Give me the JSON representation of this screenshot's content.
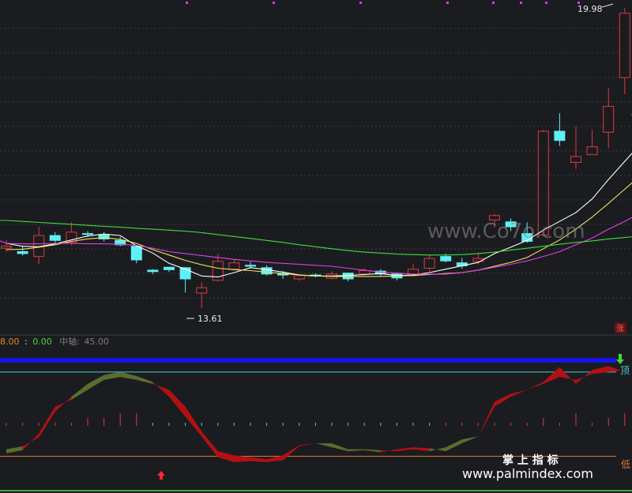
{
  "colors": {
    "background": "#1b1c20",
    "up_candle": "#e0393e",
    "down_candle": "#5ef0f4",
    "ma5": "#ffffff",
    "ma10": "#f0e25a",
    "ma20": "#e040e8",
    "ma60": "#3ddc3d",
    "band_bull": "#b31014",
    "band_bear": "#5a6d2e",
    "top_line": "#1616e8",
    "top_ref": "#3fd3d3",
    "low_ref": "#e07a2e",
    "bottom_line": "#3ddc3d",
    "grid": "#3a3d47"
  },
  "price_panel": {
    "high_label": "19.98",
    "low_label": "13.61",
    "zhang_badge": "涨",
    "watermark": "www.Co7o.com"
  },
  "indicator_panel": {
    "header": {
      "value_a": "8.00",
      "separator": ":",
      "value_b": "0.00",
      "axis_label": "中轴:",
      "axis_value": "45.00"
    },
    "top_marker": "顶",
    "low_marker": "低",
    "brand_cn": "掌 上 指 标",
    "brand_url": "www.palmindex.com"
  },
  "chart_data": [
    {
      "type": "candlestick",
      "title": "",
      "y_labels": {
        "high": 19.98,
        "low": 13.61
      },
      "candles": [
        {
          "o": 15.05,
          "h": 15.22,
          "l": 14.98,
          "c": 15.09
        },
        {
          "o": 14.98,
          "h": 15.1,
          "l": 14.9,
          "c": 14.94
        },
        {
          "o": 14.88,
          "h": 15.49,
          "l": 14.72,
          "c": 15.31
        },
        {
          "o": 15.31,
          "h": 15.38,
          "l": 15.16,
          "c": 15.21
        },
        {
          "o": 15.17,
          "h": 15.58,
          "l": 15.11,
          "c": 15.38
        },
        {
          "o": 15.35,
          "h": 15.4,
          "l": 15.28,
          "c": 15.34
        },
        {
          "o": 15.33,
          "h": 15.38,
          "l": 15.19,
          "c": 15.24
        },
        {
          "o": 15.21,
          "h": 15.28,
          "l": 15.09,
          "c": 15.12
        },
        {
          "o": 15.09,
          "h": 15.11,
          "l": 14.74,
          "c": 14.81
        },
        {
          "o": 14.6,
          "h": 14.62,
          "l": 14.52,
          "c": 14.57
        },
        {
          "o": 14.66,
          "h": 14.66,
          "l": 14.56,
          "c": 14.61
        },
        {
          "o": 14.65,
          "h": 14.66,
          "l": 14.14,
          "c": 14.42
        },
        {
          "o": 14.13,
          "h": 14.35,
          "l": 13.82,
          "c": 14.24
        },
        {
          "o": 14.39,
          "h": 14.94,
          "l": 14.37,
          "c": 14.78
        },
        {
          "o": 14.62,
          "h": 14.82,
          "l": 14.62,
          "c": 14.75
        },
        {
          "o": 14.7,
          "h": 14.77,
          "l": 14.63,
          "c": 14.68
        },
        {
          "o": 14.65,
          "h": 14.7,
          "l": 14.49,
          "c": 14.52
        },
        {
          "o": 14.53,
          "h": 14.58,
          "l": 14.42,
          "c": 14.5
        },
        {
          "o": 14.42,
          "h": 14.52,
          "l": 14.38,
          "c": 14.49
        },
        {
          "o": 14.5,
          "h": 14.53,
          "l": 14.45,
          "c": 14.48
        },
        {
          "o": 14.43,
          "h": 14.58,
          "l": 14.41,
          "c": 14.52
        },
        {
          "o": 14.54,
          "h": 14.55,
          "l": 14.37,
          "c": 14.42
        },
        {
          "o": 14.52,
          "h": 14.64,
          "l": 14.49,
          "c": 14.59
        },
        {
          "o": 14.58,
          "h": 14.62,
          "l": 14.48,
          "c": 14.52
        },
        {
          "o": 14.52,
          "h": 14.54,
          "l": 14.39,
          "c": 14.44
        },
        {
          "o": 14.49,
          "h": 14.72,
          "l": 14.47,
          "c": 14.62
        },
        {
          "o": 14.64,
          "h": 14.92,
          "l": 14.57,
          "c": 14.84
        },
        {
          "o": 14.88,
          "h": 14.94,
          "l": 14.76,
          "c": 14.79
        },
        {
          "o": 14.75,
          "h": 14.85,
          "l": 14.63,
          "c": 14.69
        },
        {
          "o": 14.78,
          "h": 14.96,
          "l": 14.72,
          "c": 14.84
        },
        {
          "o": 15.63,
          "h": 15.75,
          "l": 15.47,
          "c": 15.72
        },
        {
          "o": 15.59,
          "h": 15.66,
          "l": 15.4,
          "c": 15.49
        },
        {
          "o": 15.35,
          "h": 15.58,
          "l": 15.16,
          "c": 15.19
        },
        {
          "o": 15.32,
          "h": 17.48,
          "l": 15.3,
          "c": 17.45
        },
        {
          "o": 17.45,
          "h": 17.82,
          "l": 17.15,
          "c": 17.26
        },
        {
          "o": 16.81,
          "h": 17.54,
          "l": 16.68,
          "c": 16.93
        },
        {
          "o": 16.97,
          "h": 17.48,
          "l": 16.97,
          "c": 17.13
        },
        {
          "o": 17.43,
          "h": 18.34,
          "l": 17.1,
          "c": 17.96
        },
        {
          "o": 18.55,
          "h": 19.98,
          "l": 18.21,
          "c": 19.87
        }
      ],
      "moving_averages": [
        {
          "name": "MA5",
          "color": "#ffffff",
          "values": [
            15.15,
            15.09,
            15.08,
            15.14,
            15.22,
            15.3,
            15.34,
            15.31,
            15.1,
            14.95,
            14.74,
            14.62,
            14.48,
            14.46,
            14.55,
            14.65,
            14.61,
            14.56,
            14.5,
            14.48,
            14.48,
            14.49,
            14.51,
            14.53,
            14.49,
            14.5,
            14.55,
            14.62,
            14.69,
            14.76,
            14.94,
            15.07,
            15.21,
            15.42,
            15.6,
            15.78,
            16.06,
            16.46,
            16.83,
            17.2
          ]
        },
        {
          "name": "MA10",
          "color": "#f0e25a",
          "values": [
            15.02,
            15.03,
            15.07,
            15.12,
            15.19,
            15.24,
            15.27,
            15.23,
            15.15,
            15.02,
            14.91,
            14.8,
            14.71,
            14.64,
            14.61,
            14.59,
            14.56,
            14.53,
            14.5,
            14.48,
            14.47,
            14.47,
            14.47,
            14.47,
            14.48,
            14.49,
            14.51,
            14.53,
            14.55,
            14.6,
            14.68,
            14.76,
            14.86,
            15.04,
            15.22,
            15.44,
            15.69,
            15.97,
            16.26,
            16.55
          ]
        },
        {
          "name": "MA20",
          "color": "#e040e8",
          "values": [
            15.15,
            15.14,
            15.14,
            15.15,
            15.15,
            15.14,
            15.14,
            15.13,
            15.11,
            15.05,
            14.98,
            14.94,
            14.9,
            14.86,
            14.82,
            14.79,
            14.76,
            14.74,
            14.72,
            14.7,
            14.68,
            14.64,
            14.6,
            14.56,
            14.54,
            14.52,
            14.52,
            14.52,
            14.55,
            14.6,
            14.66,
            14.72,
            14.79,
            14.88,
            14.98,
            15.12,
            15.26,
            15.44,
            15.6,
            15.78
          ]
        },
        {
          "name": "MA60",
          "color": "#3ddc3d",
          "values": [
            15.62,
            15.6,
            15.58,
            15.56,
            15.54,
            15.52,
            15.5,
            15.48,
            15.46,
            15.44,
            15.42,
            15.4,
            15.37,
            15.33,
            15.29,
            15.25,
            15.21,
            15.17,
            15.12,
            15.08,
            15.04,
            15.0,
            14.97,
            14.95,
            14.93,
            14.92,
            14.91,
            14.91,
            14.92,
            14.94,
            14.97,
            15.01,
            15.05,
            15.09,
            15.13,
            15.17,
            15.2,
            15.24,
            15.27,
            15.3
          ]
        }
      ],
      "note": "Daily K-line with MA5/MA10/MA20/MA60; last bar reaches the marked high 19.98, lowest low is the marked 13.61."
    },
    {
      "type": "area",
      "title": "",
      "header_values": {
        "a": 8.0,
        "b": 0.0,
        "axis": 45.0
      },
      "ylim": [
        -5,
        105
      ],
      "reference_lines": [
        {
          "name": "顶",
          "value": 90
        },
        {
          "name": "低",
          "value": 5
        }
      ],
      "series": [
        {
          "name": "",
          "values": [
            8,
            11,
            28,
            55,
            62,
            72,
            82,
            85,
            82,
            78,
            72,
            55,
            30,
            10,
            6,
            4,
            2,
            6,
            16,
            18,
            14,
            10,
            11,
            9,
            12,
            14,
            13,
            10,
            18,
            25,
            60,
            68,
            72,
            80,
            95,
            78,
            92,
            96,
            90,
            100
          ]
        },
        {
          "name": "",
          "values": [
            12,
            15,
            24,
            50,
            65,
            78,
            87,
            90,
            86,
            80,
            65,
            45,
            25,
            4,
            -1,
            0,
            -1,
            1,
            15,
            18,
            18,
            12,
            12,
            11,
            10,
            12,
            10,
            14,
            22,
            25,
            55,
            65,
            72,
            78,
            85,
            82,
            88,
            90,
            92,
            95
          ]
        }
      ],
      "bars": [
        0,
        0,
        0,
        0,
        0,
        1,
        1,
        2,
        2,
        0,
        0,
        0,
        0,
        0,
        0,
        0,
        0,
        0,
        0,
        0,
        0,
        0,
        0,
        0,
        0,
        0,
        0,
        0,
        0,
        0,
        0,
        0,
        0,
        1,
        0,
        2,
        0,
        1,
        2,
        3
      ],
      "buy_arrow_index": 10,
      "sell_arrow_index": 39
    }
  ]
}
